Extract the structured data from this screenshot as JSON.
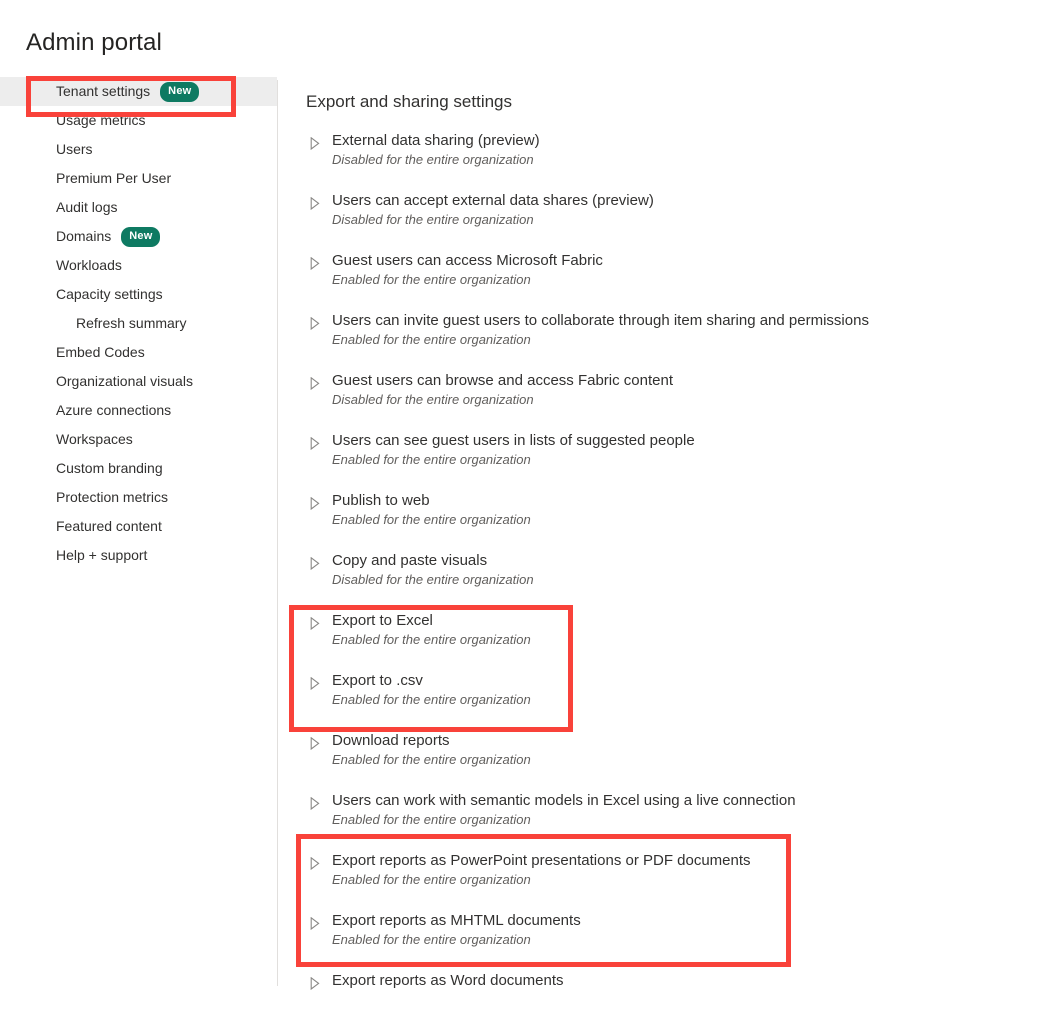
{
  "header": {
    "title": "Admin portal"
  },
  "sidebar": {
    "items": [
      {
        "label": "Tenant settings",
        "badge": "New",
        "selected": true,
        "sub": false
      },
      {
        "label": "Usage metrics",
        "badge": "",
        "selected": false,
        "sub": false
      },
      {
        "label": "Users",
        "badge": "",
        "selected": false,
        "sub": false
      },
      {
        "label": "Premium Per User",
        "badge": "",
        "selected": false,
        "sub": false
      },
      {
        "label": "Audit logs",
        "badge": "",
        "selected": false,
        "sub": false
      },
      {
        "label": "Domains",
        "badge": "New",
        "selected": false,
        "sub": false
      },
      {
        "label": "Workloads",
        "badge": "",
        "selected": false,
        "sub": false
      },
      {
        "label": "Capacity settings",
        "badge": "",
        "selected": false,
        "sub": false
      },
      {
        "label": "Refresh summary",
        "badge": "",
        "selected": false,
        "sub": true
      },
      {
        "label": "Embed Codes",
        "badge": "",
        "selected": false,
        "sub": false
      },
      {
        "label": "Organizational visuals",
        "badge": "",
        "selected": false,
        "sub": false
      },
      {
        "label": "Azure connections",
        "badge": "",
        "selected": false,
        "sub": false
      },
      {
        "label": "Workspaces",
        "badge": "",
        "selected": false,
        "sub": false
      },
      {
        "label": "Custom branding",
        "badge": "",
        "selected": false,
        "sub": false
      },
      {
        "label": "Protection metrics",
        "badge": "",
        "selected": false,
        "sub": false
      },
      {
        "label": "Featured content",
        "badge": "",
        "selected": false,
        "sub": false
      },
      {
        "label": "Help + support",
        "badge": "",
        "selected": false,
        "sub": false
      }
    ]
  },
  "main": {
    "section_title": "Export and sharing settings",
    "expand_icon": "triangle-right-icon",
    "settings": [
      {
        "name": "External data sharing (preview)",
        "status": "Disabled for the entire organization"
      },
      {
        "name": "Users can accept external data shares (preview)",
        "status": "Disabled for the entire organization"
      },
      {
        "name": "Guest users can access Microsoft Fabric",
        "status": "Enabled for the entire organization"
      },
      {
        "name": "Users can invite guest users to collaborate through item sharing and permissions",
        "status": "Enabled for the entire organization"
      },
      {
        "name": "Guest users can browse and access Fabric content",
        "status": "Disabled for the entire organization"
      },
      {
        "name": "Users can see guest users in lists of suggested people",
        "status": "Enabled for the entire organization"
      },
      {
        "name": "Publish to web",
        "status": "Enabled for the entire organization"
      },
      {
        "name": "Copy and paste visuals",
        "status": "Disabled for the entire organization"
      },
      {
        "name": "Export to Excel",
        "status": "Enabled for the entire organization"
      },
      {
        "name": "Export to .csv",
        "status": "Enabled for the entire organization"
      },
      {
        "name": "Download reports",
        "status": "Enabled for the entire organization"
      },
      {
        "name": "Users can work with semantic models in Excel using a live connection",
        "status": "Enabled for the entire organization"
      },
      {
        "name": "Export reports as PowerPoint presentations or PDF documents",
        "status": "Enabled for the entire organization"
      },
      {
        "name": "Export reports as MHTML documents",
        "status": "Enabled for the entire organization"
      },
      {
        "name": "Export reports as Word documents",
        "status": ""
      }
    ]
  },
  "annotations": {
    "highlight_color": "#f9423a",
    "boxes": [
      {
        "target": "Tenant settings"
      },
      {
        "target": "Export to Excel / Export to .csv"
      },
      {
        "target": "Export reports as PowerPoint presentations or PDF documents / Export reports as MHTML documents"
      }
    ]
  },
  "colors": {
    "badge_green": "#0e7a62",
    "selected_row": "#ededed",
    "text_primary": "#323130",
    "text_secondary": "#605e5c"
  }
}
